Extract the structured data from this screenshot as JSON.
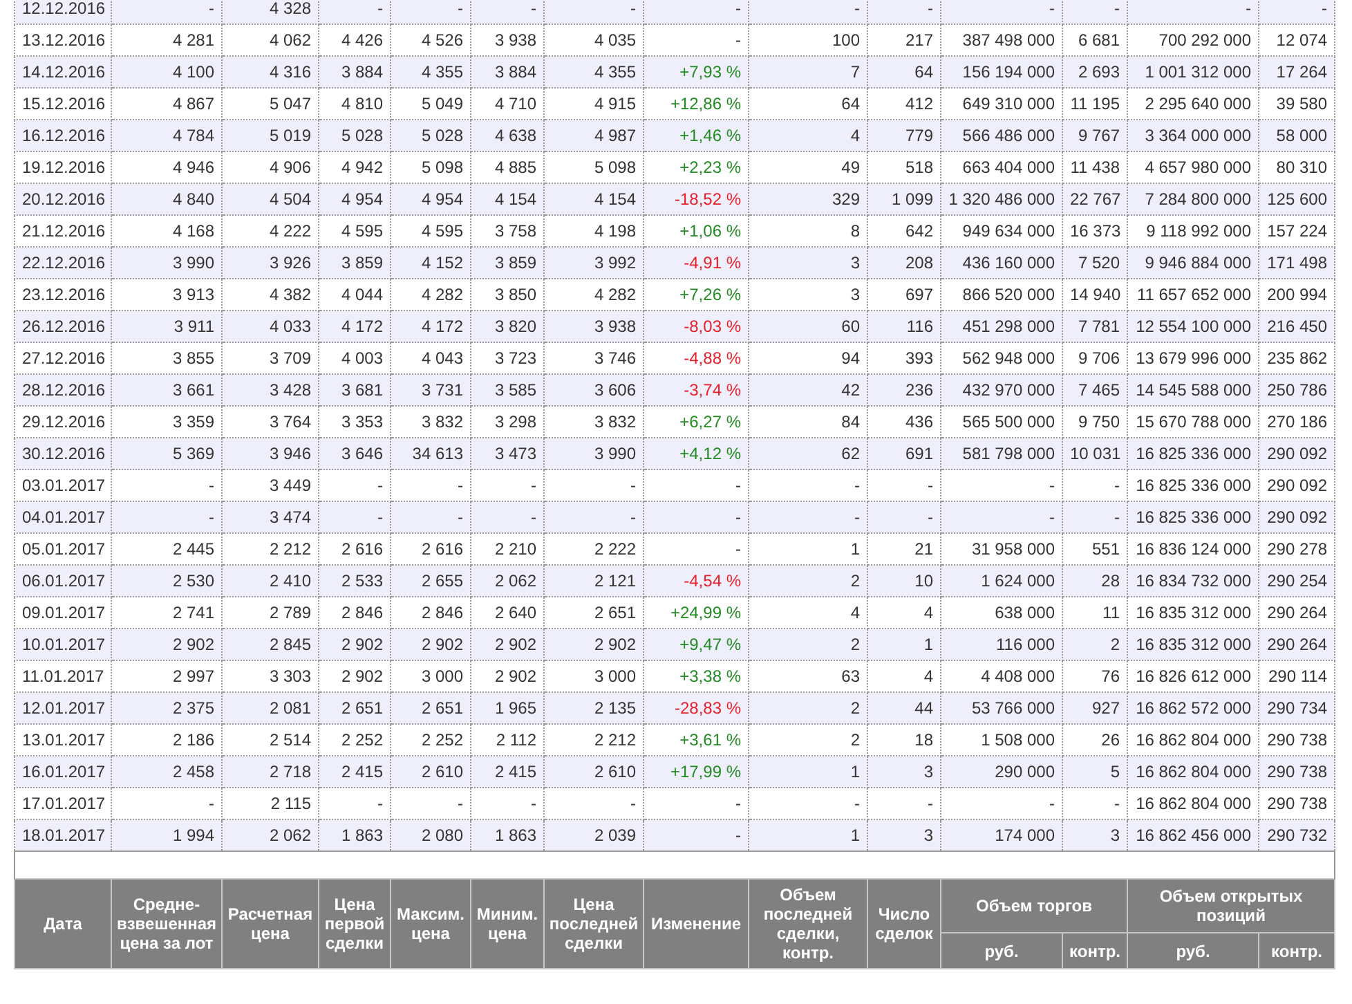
{
  "table": {
    "rows": [
      {
        "cells": [
          "12.12.2016",
          "-",
          "4 328",
          "-",
          "-",
          "-",
          "-",
          "-",
          "-",
          "-",
          "-",
          "-",
          "-",
          "-"
        ],
        "color": "#333333"
      },
      {
        "cells": [
          "13.12.2016",
          "4 281",
          "4 062",
          "4 426",
          "4 526",
          "3 938",
          "4 035",
          "-",
          "100",
          "217",
          "387 498 000",
          "6 681",
          "700 292 000",
          "12 074"
        ],
        "color": "#333333"
      },
      {
        "cells": [
          "14.12.2016",
          "4 100",
          "4 316",
          "3 884",
          "4 355",
          "3 884",
          "4 355",
          "+7,93 %",
          "7",
          "64",
          "156 194 000",
          "2 693",
          "1 001 312 000",
          "17 264"
        ],
        "color": "#228b22"
      },
      {
        "cells": [
          "15.12.2016",
          "4 867",
          "5 047",
          "4 810",
          "5 049",
          "4 710",
          "4 915",
          "+12,86 %",
          "64",
          "412",
          "649 310 000",
          "11 195",
          "2 295 640 000",
          "39 580"
        ],
        "color": "#228b22"
      },
      {
        "cells": [
          "16.12.2016",
          "4 784",
          "5 019",
          "5 028",
          "5 028",
          "4 638",
          "4 987",
          "+1,46 %",
          "4",
          "779",
          "566 486 000",
          "9 767",
          "3 364 000 000",
          "58 000"
        ],
        "color": "#228b22"
      },
      {
        "cells": [
          "19.12.2016",
          "4 946",
          "4 906",
          "4 942",
          "5 098",
          "4 885",
          "5 098",
          "+2,23 %",
          "49",
          "518",
          "663 404 000",
          "11 438",
          "4 657 980 000",
          "80 310"
        ],
        "color": "#228b22"
      },
      {
        "cells": [
          "20.12.2016",
          "4 840",
          "4 504",
          "4 954",
          "4 954",
          "4 154",
          "4 154",
          "-18,52 %",
          "329",
          "1 099",
          "1 320 486 000",
          "22 767",
          "7 284 800 000",
          "125 600"
        ],
        "color": "#e8202a"
      },
      {
        "cells": [
          "21.12.2016",
          "4 168",
          "4 222",
          "4 595",
          "4 595",
          "3 758",
          "4 198",
          "+1,06 %",
          "8",
          "642",
          "949 634 000",
          "16 373",
          "9 118 992 000",
          "157 224"
        ],
        "color": "#228b22"
      },
      {
        "cells": [
          "22.12.2016",
          "3 990",
          "3 926",
          "3 859",
          "4 152",
          "3 859",
          "3 992",
          "-4,91 %",
          "3",
          "208",
          "436 160 000",
          "7 520",
          "9 946 884 000",
          "171 498"
        ],
        "color": "#e8202a"
      },
      {
        "cells": [
          "23.12.2016",
          "3 913",
          "4 382",
          "4 044",
          "4 282",
          "3 850",
          "4 282",
          "+7,26 %",
          "3",
          "697",
          "866 520 000",
          "14 940",
          "11 657 652 000",
          "200 994"
        ],
        "color": "#228b22"
      },
      {
        "cells": [
          "26.12.2016",
          "3 911",
          "4 033",
          "4 172",
          "4 172",
          "3 820",
          "3 938",
          "-8,03 %",
          "60",
          "116",
          "451 298 000",
          "7 781",
          "12 554 100 000",
          "216 450"
        ],
        "color": "#e8202a"
      },
      {
        "cells": [
          "27.12.2016",
          "3 855",
          "3 709",
          "4 003",
          "4 043",
          "3 723",
          "3 746",
          "-4,88 %",
          "94",
          "393",
          "562 948 000",
          "9 706",
          "13 679 996 000",
          "235 862"
        ],
        "color": "#e8202a"
      },
      {
        "cells": [
          "28.12.2016",
          "3 661",
          "3 428",
          "3 681",
          "3 731",
          "3 585",
          "3 606",
          "-3,74 %",
          "42",
          "236",
          "432 970 000",
          "7 465",
          "14 545 588 000",
          "250 786"
        ],
        "color": "#e8202a"
      },
      {
        "cells": [
          "29.12.2016",
          "3 359",
          "3 764",
          "3 353",
          "3 832",
          "3 298",
          "3 832",
          "+6,27 %",
          "84",
          "436",
          "565 500 000",
          "9 750",
          "15 670 788 000",
          "270 186"
        ],
        "color": "#228b22"
      },
      {
        "cells": [
          "30.12.2016",
          "5 369",
          "3 946",
          "3 646",
          "34 613",
          "3 473",
          "3 990",
          "+4,12 %",
          "62",
          "691",
          "581 798 000",
          "10 031",
          "16 825 336 000",
          "290 092"
        ],
        "color": "#228b22"
      },
      {
        "cells": [
          "03.01.2017",
          "-",
          "3 449",
          "-",
          "-",
          "-",
          "-",
          "-",
          "-",
          "-",
          "-",
          "-",
          "16 825 336 000",
          "290 092"
        ],
        "color": "#333333"
      },
      {
        "cells": [
          "04.01.2017",
          "-",
          "3 474",
          "-",
          "-",
          "-",
          "-",
          "-",
          "-",
          "-",
          "-",
          "-",
          "16 825 336 000",
          "290 092"
        ],
        "color": "#333333"
      },
      {
        "cells": [
          "05.01.2017",
          "2 445",
          "2 212",
          "2 616",
          "2 616",
          "2 210",
          "2 222",
          "-",
          "1",
          "21",
          "31 958 000",
          "551",
          "16 836 124 000",
          "290 278"
        ],
        "color": "#333333"
      },
      {
        "cells": [
          "06.01.2017",
          "2 530",
          "2 410",
          "2 533",
          "2 655",
          "2 062",
          "2 121",
          "-4,54 %",
          "2",
          "10",
          "1 624 000",
          "28",
          "16 834 732 000",
          "290 254"
        ],
        "color": "#e8202a"
      },
      {
        "cells": [
          "09.01.2017",
          "2 741",
          "2 789",
          "2 846",
          "2 846",
          "2 640",
          "2 651",
          "+24,99 %",
          "4",
          "4",
          "638 000",
          "11",
          "16 835 312 000",
          "290 264"
        ],
        "color": "#228b22"
      },
      {
        "cells": [
          "10.01.2017",
          "2 902",
          "2 845",
          "2 902",
          "2 902",
          "2 902",
          "2 902",
          "+9,47 %",
          "2",
          "1",
          "116 000",
          "2",
          "16 835 312 000",
          "290 264"
        ],
        "color": "#228b22"
      },
      {
        "cells": [
          "11.01.2017",
          "2 997",
          "3 303",
          "2 902",
          "3 000",
          "2 902",
          "3 000",
          "+3,38 %",
          "63",
          "4",
          "4 408 000",
          "76",
          "16 826 612 000",
          "290 114"
        ],
        "color": "#228b22"
      },
      {
        "cells": [
          "12.01.2017",
          "2 375",
          "2 081",
          "2 651",
          "2 651",
          "1 965",
          "2 135",
          "-28,83 %",
          "2",
          "44",
          "53 766 000",
          "927",
          "16 862 572 000",
          "290 734"
        ],
        "color": "#e8202a"
      },
      {
        "cells": [
          "13.01.2017",
          "2 186",
          "2 514",
          "2 252",
          "2 252",
          "2 112",
          "2 212",
          "+3,61 %",
          "2",
          "18",
          "1 508 000",
          "26",
          "16 862 804 000",
          "290 738"
        ],
        "color": "#228b22"
      },
      {
        "cells": [
          "16.01.2017",
          "2 458",
          "2 718",
          "2 415",
          "2 610",
          "2 415",
          "2 610",
          "+17,99 %",
          "1",
          "3",
          "290 000",
          "5",
          "16 862 804 000",
          "290 738"
        ],
        "color": "#228b22"
      },
      {
        "cells": [
          "17.01.2017",
          "-",
          "2 115",
          "-",
          "-",
          "-",
          "-",
          "-",
          "-",
          "-",
          "-",
          "-",
          "16 862 804 000",
          "290 738"
        ],
        "color": "#333333"
      },
      {
        "cells": [
          "18.01.2017",
          "1 994",
          "2 062",
          "1 863",
          "2 080",
          "1 863",
          "2 039",
          "-",
          "1",
          "3",
          "174 000",
          "3",
          "16 862 456 000",
          "290 732"
        ],
        "color": "#333333"
      }
    ],
    "bottom_header": {
      "labels": [
        "Дата",
        "Средне-взвешенная цена за лот",
        "Расчетная цена",
        "Цена первой сделки",
        "Максим. цена",
        "Миним. цена",
        "Цена последней сделки",
        "Изменение",
        "Объем последней сделки, контр.",
        "Число сделок"
      ],
      "groups": [
        {
          "label": "Объем торгов",
          "subcolumns": [
            "руб.",
            "контр."
          ]
        },
        {
          "label": "Объем открытых позиций",
          "subcolumns": [
            "руб.",
            "контр."
          ]
        }
      ]
    }
  }
}
